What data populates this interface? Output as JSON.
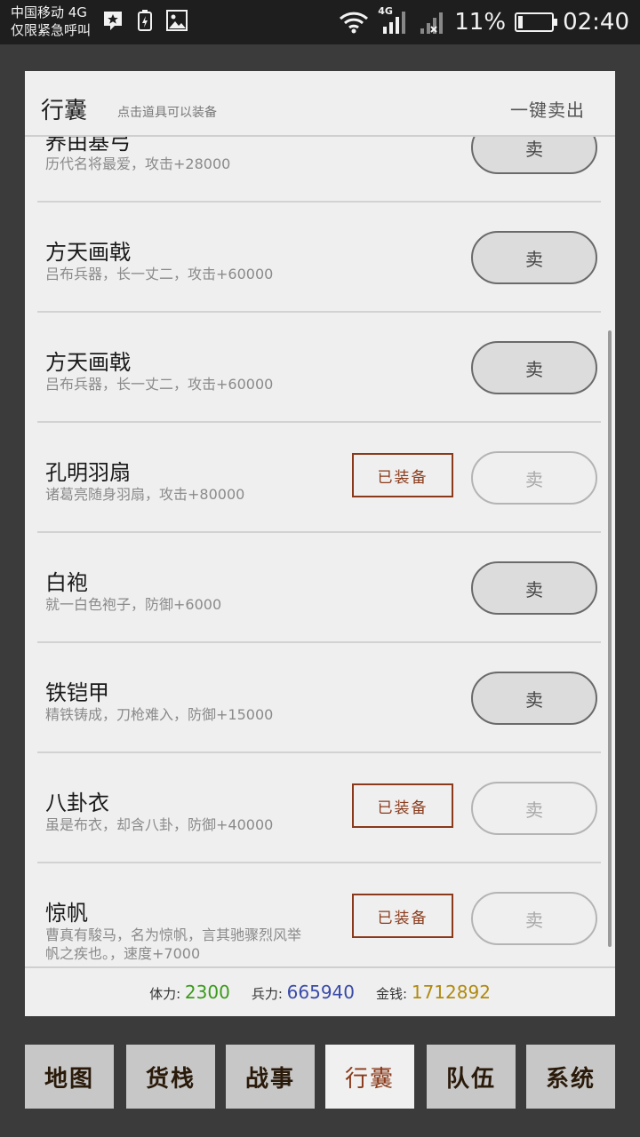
{
  "status": {
    "carrier_line1": "中国移动 4G",
    "carrier_line2": "仅限紧急呼叫",
    "network_tag": "4G",
    "battery": "11%",
    "time": "02:40"
  },
  "panel": {
    "title": "行囊",
    "hint": "点击道具可以装备",
    "sell_all": "一键卖出",
    "sell_label": "卖",
    "equipped_label": "已装备",
    "items": [
      {
        "name": "养由基弓",
        "desc": "历代名将最爱，攻击+28000",
        "equipped": false
      },
      {
        "name": "方天画戟",
        "desc": "吕布兵器，长一丈二，攻击+60000",
        "equipped": false
      },
      {
        "name": "方天画戟",
        "desc": "吕布兵器，长一丈二，攻击+60000",
        "equipped": false
      },
      {
        "name": "孔明羽扇",
        "desc": "诸葛亮随身羽扇，攻击+80000",
        "equipped": true
      },
      {
        "name": "白袍",
        "desc": "就一白色袍子，防御+6000",
        "equipped": false
      },
      {
        "name": "铁铠甲",
        "desc": "精铁铸成，刀枪难入，防御+15000",
        "equipped": false
      },
      {
        "name": "八卦衣",
        "desc": "虽是布衣，却含八卦，防御+40000",
        "equipped": true
      },
      {
        "name": "惊帆",
        "desc": "曹真有駿马，名为惊帆，言其驰骤烈风举帆之疾也。，速度+7000",
        "equipped": true
      }
    ]
  },
  "stats": {
    "stamina_label": "体力:",
    "stamina": "2300",
    "troops_label": "兵力:",
    "troops": "665940",
    "gold_label": "金钱:",
    "gold": "1712892"
  },
  "nav": {
    "items": [
      "地图",
      "货栈",
      "战事",
      "行囊",
      "队伍",
      "系统"
    ],
    "active": "行囊"
  }
}
